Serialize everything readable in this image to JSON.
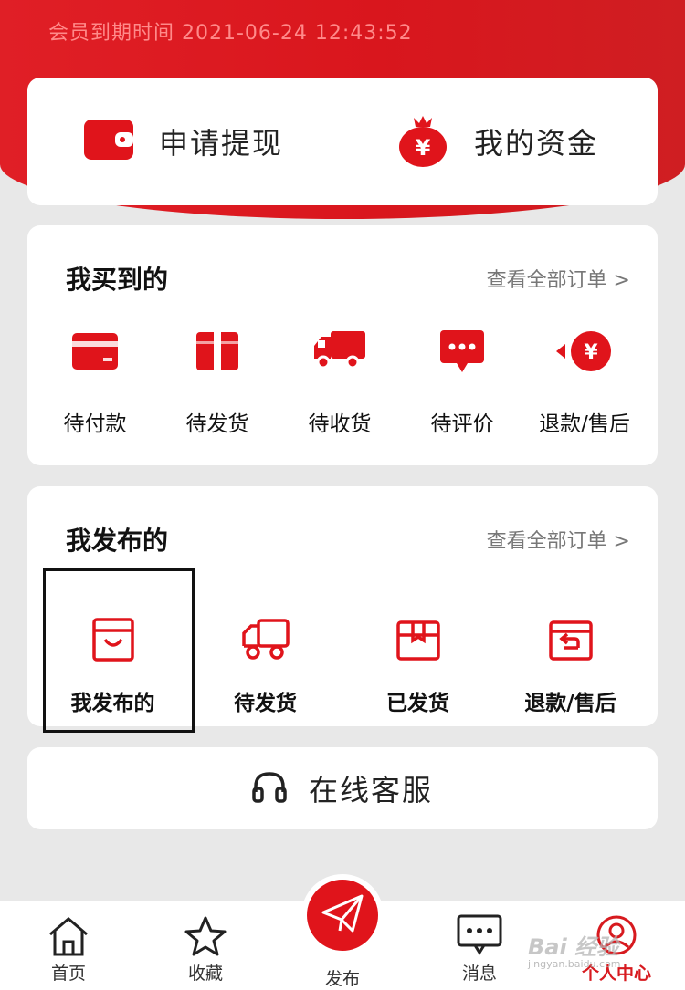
{
  "header": {
    "expiry_text": "会员到期时间 2021-06-24 12:43:52"
  },
  "wallet": {
    "withdraw_label": "申请提现",
    "funds_label": "我的资金"
  },
  "bought": {
    "title": "我买到的",
    "view_all": "查看全部订单 >",
    "items": [
      {
        "label": "待付款",
        "icon": "card-icon"
      },
      {
        "label": "待发货",
        "icon": "gift-box-icon"
      },
      {
        "label": "待收货",
        "icon": "truck-icon"
      },
      {
        "label": "待评价",
        "icon": "chat-icon"
      },
      {
        "label": "退款/售后",
        "icon": "refund-icon"
      }
    ]
  },
  "published": {
    "title": "我发布的",
    "view_all": "查看全部订单 >",
    "items": [
      {
        "label": "我发布的",
        "icon": "shop-bag-icon"
      },
      {
        "label": "待发货",
        "icon": "truck-outline-icon"
      },
      {
        "label": "已发货",
        "icon": "package-icon"
      },
      {
        "label": "退款/售后",
        "icon": "return-icon"
      }
    ]
  },
  "service": {
    "label": "在线客服"
  },
  "tabbar": {
    "home": "首页",
    "favorites": "收藏",
    "publish": "发布",
    "messages": "消息",
    "profile": "个人中心"
  },
  "watermark": {
    "text": "Bai 经验",
    "sub": "jingyan.baidu.com"
  },
  "colors": {
    "brand_red": "#e0141b",
    "expiry_text": "#ff8a8a",
    "background": "#e8e8e8"
  }
}
